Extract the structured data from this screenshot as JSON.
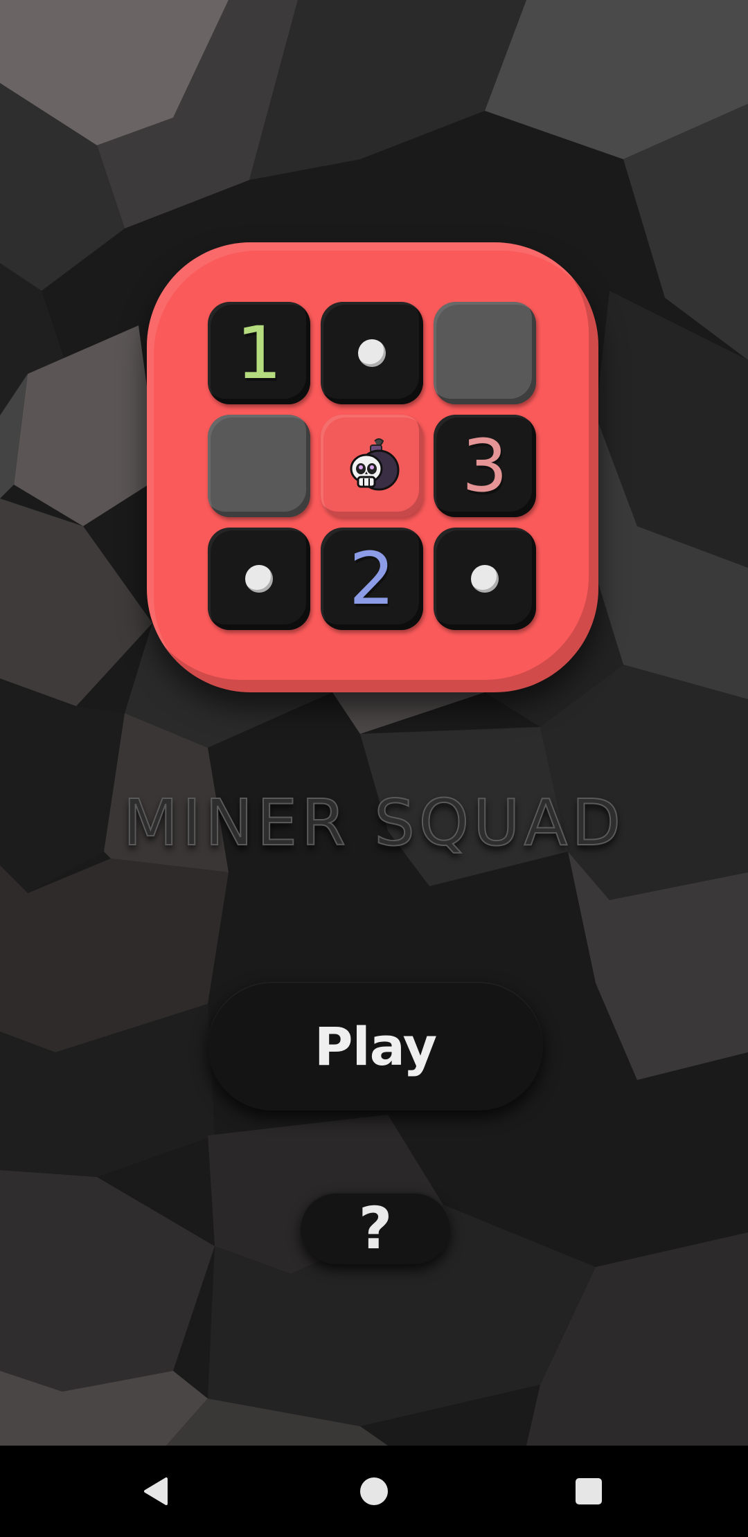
{
  "app": {
    "title": "MINER SQUAD"
  },
  "logo": {
    "tiles": [
      {
        "kind": "number",
        "value": "1",
        "color": "#b5dc7e"
      },
      {
        "kind": "dot"
      },
      {
        "kind": "hidden"
      },
      {
        "kind": "hidden"
      },
      {
        "kind": "bomb",
        "icon": "skull-bomb-icon"
      },
      {
        "kind": "number",
        "value": "3",
        "color": "#e59595"
      },
      {
        "kind": "dot"
      },
      {
        "kind": "number",
        "value": "2",
        "color": "#8c9ce6"
      },
      {
        "kind": "dot"
      }
    ],
    "colors": {
      "frame": "#fa5a5a",
      "tile": "#181818",
      "hidden_tile": "#595959"
    }
  },
  "buttons": {
    "play_label": "Play",
    "help_label": "?"
  },
  "navbar": {
    "back_icon": "back-triangle-icon",
    "home_icon": "home-circle-icon",
    "recents_icon": "recents-square-icon"
  }
}
